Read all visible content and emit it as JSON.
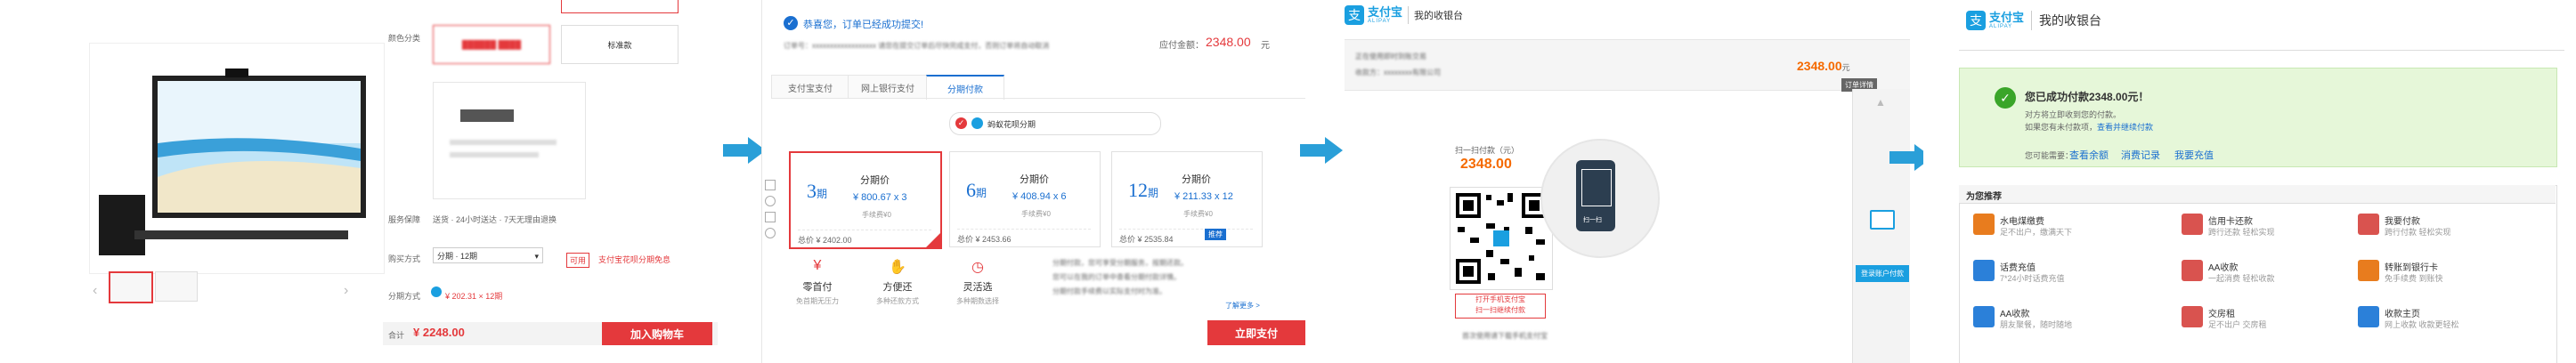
{
  "panel1": {
    "labels": {
      "color": "颜色分类",
      "option_b": "标准款",
      "service": "服务保障",
      "service_text": "送货 · 24小时送达 · 7天无理由退换",
      "qty": "购买方式",
      "qty_value": "分期 · 12期",
      "promo": "可用",
      "promo_note": "支付宝花呗分期免息",
      "installment": "分期方式",
      "installment_text": "¥ 202.31 × 12期",
      "subtotal_label": "合计",
      "price": "¥ 2248.00",
      "add_to_cart": "加入购物车"
    }
  },
  "panel2": {
    "title": "恭喜您，订单已经成功提交!",
    "order_info": "订单号：xxxxxxxxxxxxxxxxxx  请您在提交订单后尽快完成支付，否则订单将自动取消",
    "amount_label": "应付金额：",
    "amount": "2348.00",
    "amount_unit": "元",
    "tabs": [
      "支付宝支付",
      "网上银行支付",
      "分期付款"
    ],
    "installment_toggle": "蚂蚁花呗分期",
    "plans": [
      {
        "num": "3",
        "unit": "期",
        "label": "分期价",
        "amount": "¥ 800.67 x 3",
        "fee": "手续费¥0",
        "total": "总价 ¥ 2402.00"
      },
      {
        "num": "6",
        "unit": "期",
        "label": "分期价",
        "amount": "¥ 408.94 x 6",
        "fee": "手续费¥0",
        "total": "总价 ¥ 2453.66"
      },
      {
        "num": "12",
        "unit": "期",
        "label": "分期价",
        "amount": "¥ 211.33 x 12",
        "fee": "手续费¥0",
        "total": "总价 ¥ 2535.84",
        "badge": "推荐"
      }
    ],
    "features": [
      {
        "name": "零首付",
        "desc": "免首期无压力"
      },
      {
        "name": "方便还",
        "desc": "多种还款方式"
      },
      {
        "name": "灵活选",
        "desc": "多种期数选择"
      }
    ],
    "notes": [
      "分期付款，您可享受分期服务，按期还款。",
      "您可以在我的订单中查看分期付款详情。",
      "分期付款手续费以实际支付时为准。"
    ],
    "note_link": "了解更多 >",
    "pay_button": "立即支付"
  },
  "panel3": {
    "logo_text": "支付宝",
    "logo_sub": "ALIPAY",
    "page_title": "我的收银台",
    "info_line1": "正在使用即时到账交易",
    "info_line2": "收款方：xxxxxxxx有限公司",
    "amount": "2348.00",
    "amount_unit": "元",
    "detail_btn": "订单详情",
    "qr_title": "扫一扫付款（元）",
    "qr_amount": "2348.00",
    "qr_caption": "打开手机支付宝\n扫一扫继续付款",
    "qr_footer": "首次使用请下载手机支付宝",
    "phone_caption": "扫一扫",
    "login_btn": "登录账户付款"
  },
  "panel4": {
    "logo_text": "支付宝",
    "logo_sub": "ALIPAY",
    "page_title": "我的收银台",
    "success_title": "您已成功付款2348.00元！",
    "success_line1": "对方将立即收到您的付款。",
    "success_line2": "如果您有未付款项，",
    "success_link": "查看并继续付款",
    "more_label": "您可能需要：",
    "more_links": [
      "查看余额",
      "消费记录",
      "我要充值"
    ],
    "services_title": "为您推荐",
    "services": [
      {
        "name": "水电煤缴费",
        "desc": "足不出户，缴满天下",
        "color": "#e87c1e"
      },
      {
        "name": "信用卡还款",
        "desc": "跨行还款 轻松实现",
        "color": "#d9534f"
      },
      {
        "name": "我要付款",
        "desc": "跨行付款 轻松实现",
        "color": "#d9534f"
      },
      {
        "name": "话费充值",
        "desc": "7*24小时话费充值",
        "color": "#2b80d9"
      },
      {
        "name": "AA收款",
        "desc": "一起消费 轻松收款",
        "color": "#d9534f"
      },
      {
        "name": "转账到银行卡",
        "desc": "免手续费 到账快",
        "color": "#e87c1e"
      },
      {
        "name": "AA收款",
        "desc": "朋友聚餐，随时随地",
        "color": "#2b80d9"
      },
      {
        "name": "交房租",
        "desc": "足不出户 交房租",
        "color": "#d9534f"
      },
      {
        "name": "收款主页",
        "desc": "网上收款 收款更轻松",
        "color": "#2b80d9"
      }
    ]
  },
  "colors": {
    "red": "#e4393c",
    "blue": "#1a6fd0",
    "alipay": "#1a9fe0",
    "orange": "#f56a00"
  }
}
